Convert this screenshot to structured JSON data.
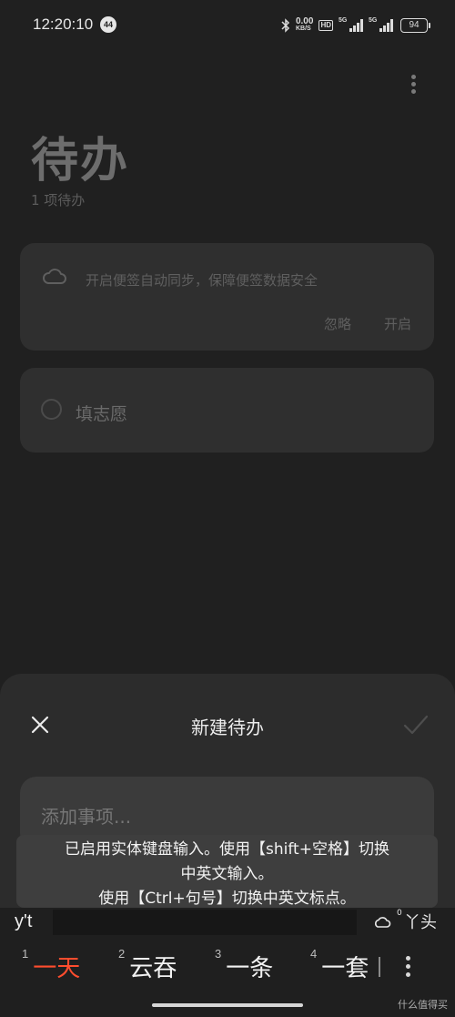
{
  "status_bar": {
    "time": "12:20:10",
    "notification_count": "44",
    "net_speed_value": "0.00",
    "net_speed_unit": "KB/S",
    "hd_label": "HD",
    "sim1_label": "5G",
    "sim2_label": "5G",
    "battery_level": "94"
  },
  "header": {
    "title": "待办",
    "subtitle": "1 项待办"
  },
  "sync_banner": {
    "text": "开启便签自动同步，保障便签数据安全",
    "ignore_label": "忽略",
    "enable_label": "开启"
  },
  "todos": [
    {
      "text": "填志愿"
    }
  ],
  "new_todo_sheet": {
    "title": "新建待办",
    "input_placeholder": "添加事项..."
  },
  "toast": {
    "line1": "已启用实体键盘输入。使用【shift+空格】切换",
    "line2": "中英文输入。",
    "line3": "使用【Ctrl+句号】切换中英文标点。"
  },
  "ime": {
    "composing": "y't",
    "degree": "0",
    "mode_switch": "丫头",
    "candidates": [
      {
        "num": "1",
        "word": "一天"
      },
      {
        "num": "2",
        "word": "云吞"
      },
      {
        "num": "3",
        "word": "一条"
      },
      {
        "num": "4",
        "word": "一套"
      }
    ]
  },
  "watermark": "什么值得买"
}
